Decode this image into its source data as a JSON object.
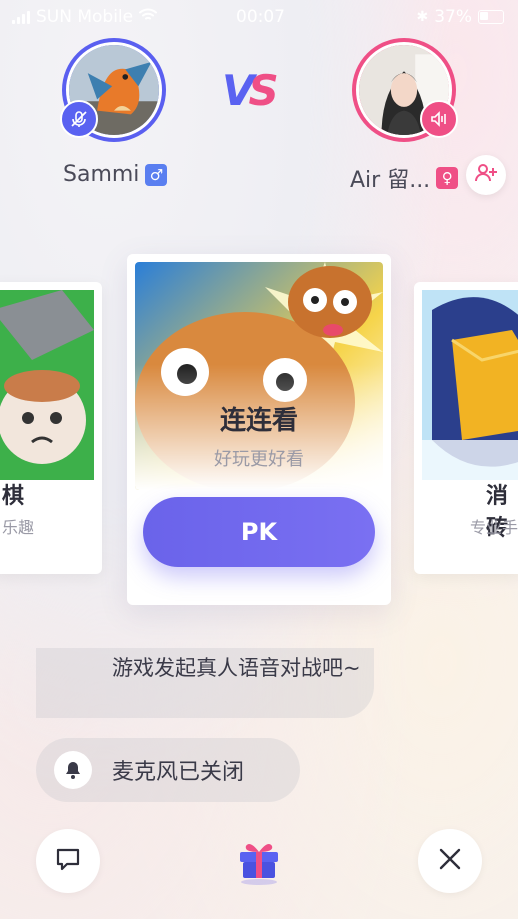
{
  "status_bar": {
    "carrier": "SUN Mobile",
    "time": "00:07",
    "battery": "37%"
  },
  "players": {
    "left": {
      "name": "Sammi",
      "gender": "♂",
      "badge_icon": "mic-off-icon"
    },
    "right": {
      "name": "Air 留...",
      "gender": "♀",
      "badge_icon": "speaker-icon"
    }
  },
  "vs": {
    "v": "V",
    "s": "S"
  },
  "games": {
    "left": {
      "title": "棋",
      "subtitle": "乐趣"
    },
    "main": {
      "title": "连连看",
      "subtitle": "好玩更好看",
      "button": "PK"
    },
    "right": {
      "title": "消砖",
      "subtitle": "专业手"
    }
  },
  "chat": {
    "message": "游戏发起真人语音对战吧~",
    "system": "麦克风已关闭"
  },
  "colors": {
    "accent_blue": "#5a62f1",
    "accent_pink": "#ef4f86",
    "pk_button": "#6a63ea"
  }
}
